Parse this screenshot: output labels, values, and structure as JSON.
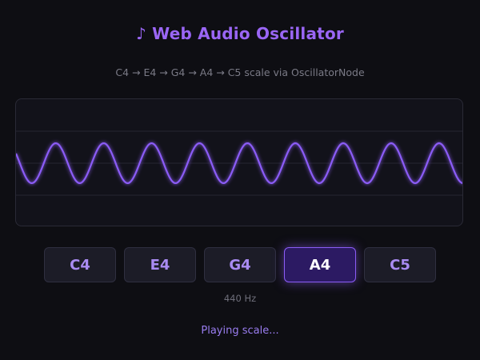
{
  "header": {
    "title_icon": "♪",
    "title": "Web Audio Oscillator",
    "subtitle": "C4 → E4 → G4 → A4 → C5 scale via OscillatorNode"
  },
  "scope": {
    "wave_color": "#8b5cf6",
    "waveform": "sine",
    "cycles_visible": 9.35,
    "amplitude_fraction": 0.78
  },
  "notes": [
    {
      "label": "C4",
      "active": false
    },
    {
      "label": "E4",
      "active": false
    },
    {
      "label": "G4",
      "active": false
    },
    {
      "label": "A4",
      "active": true
    },
    {
      "label": "C5",
      "active": false
    }
  ],
  "frequency_label": "440 Hz",
  "status": "Playing scale...",
  "colors": {
    "accent": "#9a66f5",
    "background": "#0e0e13",
    "panel": "#12121a",
    "active_button": "#2c1a63"
  }
}
